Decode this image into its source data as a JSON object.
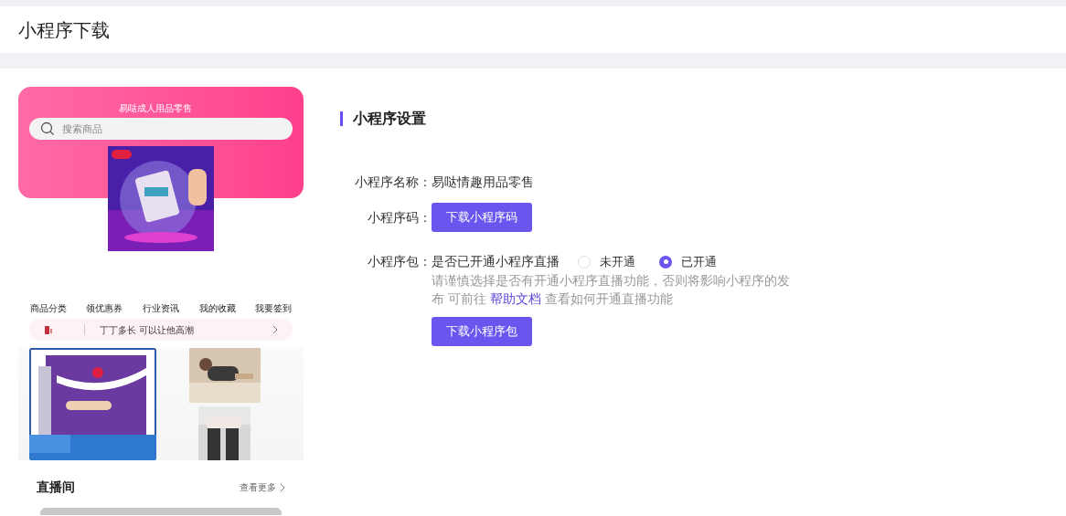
{
  "page_title": "小程序下载",
  "preview": {
    "shop_title": "易哒成人用品零售",
    "search": {
      "placeholder": "搜索商品"
    },
    "nav": [
      "商品分类",
      "领优惠券",
      "行业资讯",
      "我的收藏",
      "我要签到"
    ],
    "notice": "丁丁多长 可以让他高潮",
    "live": {
      "title": "直播间",
      "more": "查看更多"
    }
  },
  "settings": {
    "title": "小程序设置",
    "name": {
      "label": "小程序名称：",
      "value": "易哒情趣用品零售"
    },
    "code": {
      "label": "小程序码：",
      "button": "下载小程序码"
    },
    "package": {
      "label": "小程序包：",
      "question": "是否已开通小程序直播",
      "options": [
        {
          "label": "未开通",
          "selected": false
        },
        {
          "label": "已开通",
          "selected": true
        }
      ],
      "hint_before": "请谨慎选择是否有开通小程序直播功能，否则将影响小程序的发布 可前往",
      "hint_link": "帮助文档",
      "hint_after": "查看如何开通直播功能",
      "button": "下载小程序包"
    }
  }
}
